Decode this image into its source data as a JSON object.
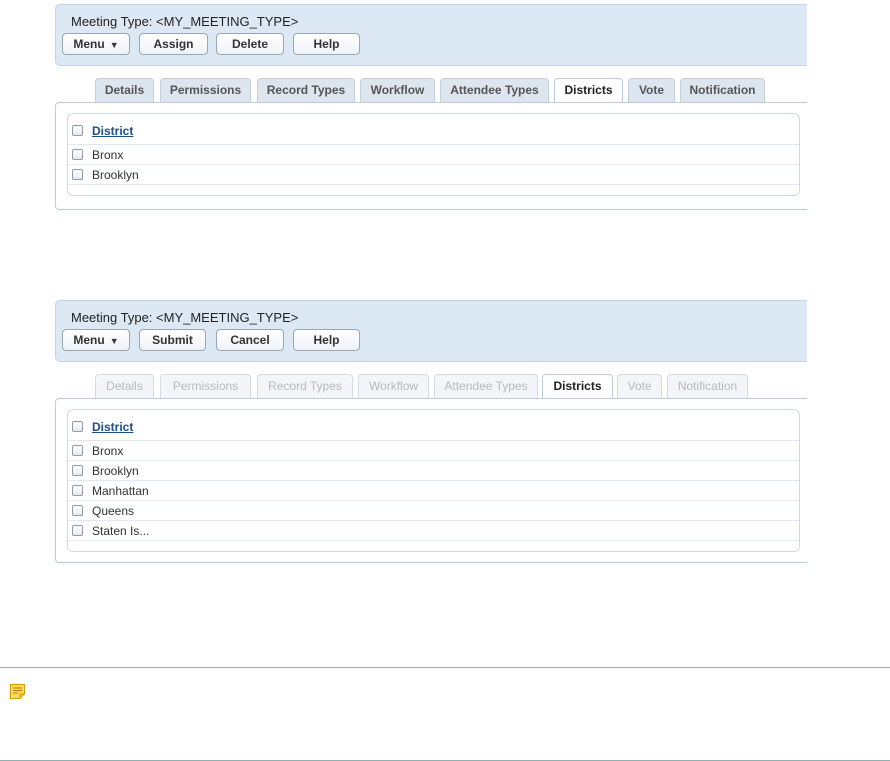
{
  "view1": {
    "title": "Meeting Type: <MY_MEETING_TYPE>",
    "buttons": {
      "menu": "Menu",
      "assign": "Assign",
      "delete": "Delete",
      "help": "Help"
    },
    "tabs": [
      "Details",
      "Permissions",
      "Record Types",
      "Workflow",
      "Attendee Types",
      "Districts",
      "Vote",
      "Notification"
    ],
    "active_tab": "Districts",
    "table": {
      "header": "District",
      "rows": [
        "Bronx",
        "Brooklyn"
      ]
    }
  },
  "view2": {
    "title": "Meeting Type: <MY_MEETING_TYPE>",
    "buttons": {
      "menu": "Menu",
      "submit": "Submit",
      "cancel": "Cancel",
      "help": "Help"
    },
    "tabs": [
      "Details",
      "Permissions",
      "Record Types",
      "Workflow",
      "Attendee Types",
      "Districts",
      "Vote",
      "Notification"
    ],
    "active_tab": "Districts",
    "table": {
      "header": "District",
      "rows": [
        "Bronx",
        "Brooklyn",
        "Manhattan",
        "Queens",
        "Staten Is..."
      ]
    }
  },
  "note": {
    "icon": "note-icon"
  }
}
